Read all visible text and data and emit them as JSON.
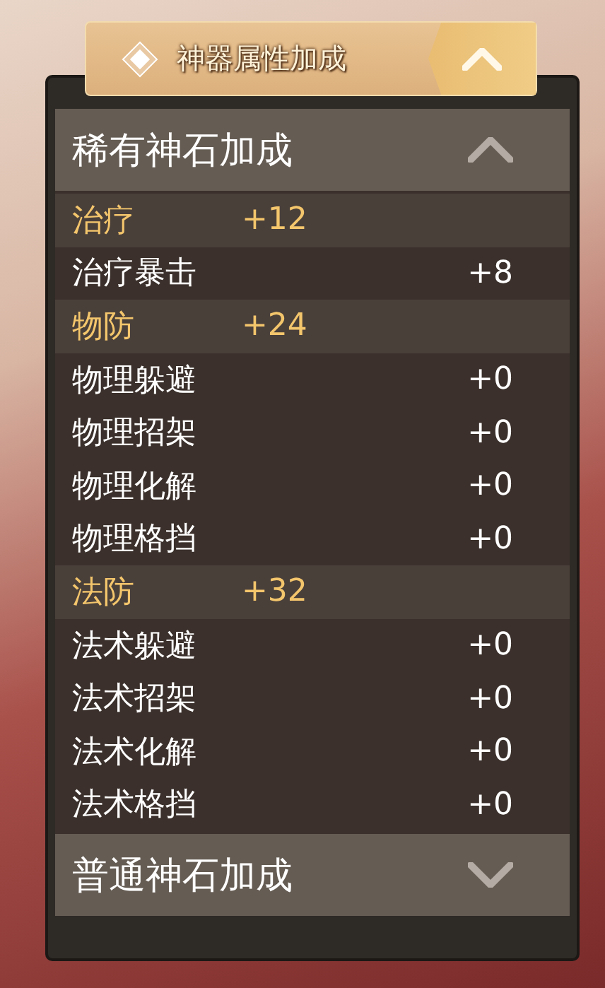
{
  "header": {
    "title": "神器属性加成",
    "expanded": true
  },
  "sections": [
    {
      "title": "稀有神石加成",
      "expanded": true,
      "groups": [
        {
          "name": "治疗",
          "total": "+12",
          "stats": [
            {
              "name": "治疗暴击",
              "value": "+8"
            }
          ]
        },
        {
          "name": "物防",
          "total": "+24",
          "stats": [
            {
              "name": "物理躲避",
              "value": "+0"
            },
            {
              "name": "物理招架",
              "value": "+0"
            },
            {
              "name": "物理化解",
              "value": "+0"
            },
            {
              "name": "物理格挡",
              "value": "+0"
            }
          ]
        },
        {
          "name": "法防",
          "total": "+32",
          "stats": [
            {
              "name": "法术躲避",
              "value": "+0"
            },
            {
              "name": "法术招架",
              "value": "+0"
            },
            {
              "name": "法术化解",
              "value": "+0"
            },
            {
              "name": "法术格挡",
              "value": "+0"
            }
          ]
        }
      ]
    },
    {
      "title": "普通神石加成",
      "expanded": false
    }
  ]
}
